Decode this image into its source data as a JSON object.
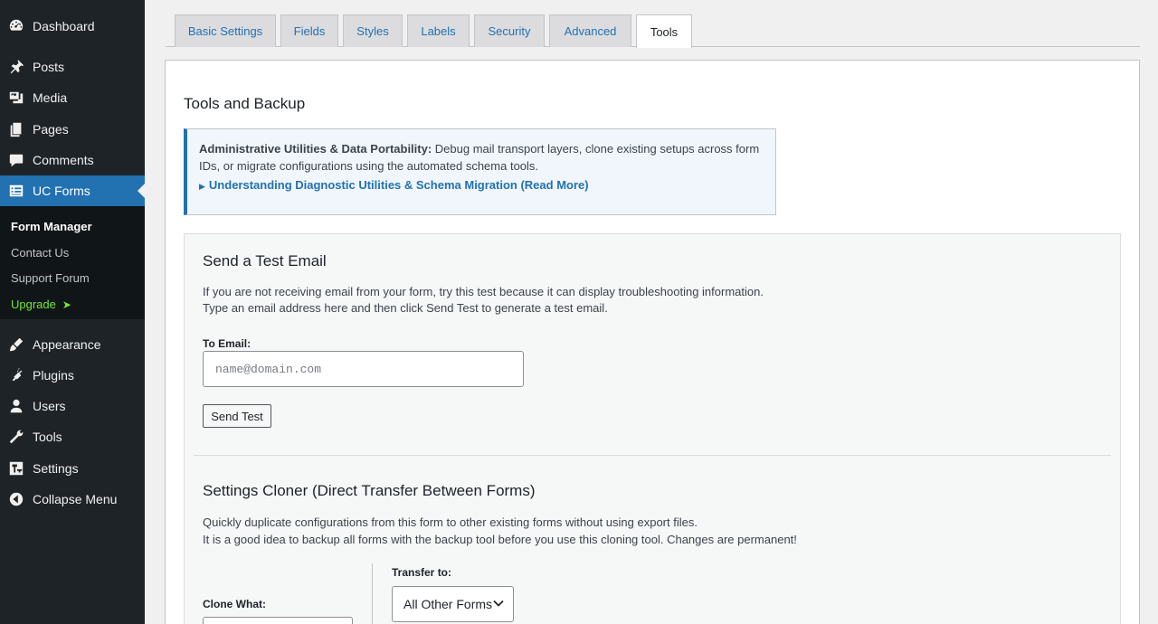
{
  "sidebar": {
    "items": [
      {
        "label": "Dashboard",
        "icon": "dashboard-icon"
      },
      {
        "label": "Posts",
        "icon": "pin-icon"
      },
      {
        "label": "Media",
        "icon": "media-icon"
      },
      {
        "label": "Pages",
        "icon": "pages-icon"
      },
      {
        "label": "Comments",
        "icon": "comment-icon"
      },
      {
        "label": "UC Forms",
        "icon": "form-icon"
      },
      {
        "label": "Appearance",
        "icon": "brush-icon"
      },
      {
        "label": "Plugins",
        "icon": "plugin-icon"
      },
      {
        "label": "Users",
        "icon": "user-icon"
      },
      {
        "label": "Tools",
        "icon": "wrench-icon"
      },
      {
        "label": "Settings",
        "icon": "settings-icon"
      },
      {
        "label": "Collapse Menu",
        "icon": "collapse-icon"
      }
    ],
    "submenu": [
      {
        "label": "Form Manager"
      },
      {
        "label": "Contact Us"
      },
      {
        "label": "Support Forum"
      },
      {
        "label": "Upgrade",
        "arrow": "➤"
      }
    ],
    "accent_color": "#2271b1",
    "upgrade_color": "#72e832"
  },
  "tabs": [
    "Basic Settings",
    "Fields",
    "Styles",
    "Labels",
    "Security",
    "Advanced",
    "Tools"
  ],
  "active_tab": "Tools",
  "panel": {
    "title": "Tools and Backup",
    "notice": {
      "strong": "Administrative Utilities & Data Portability:",
      "text": " Debug mail transport layers, clone existing setups across form IDs, or migrate configurations using the automated schema tools.",
      "link": "Understanding Diagnostic Utilities & Schema Migration (Read More)",
      "link_marker": "▶"
    },
    "test_email": {
      "title": "Send a Test Email",
      "desc1": "If you are not receiving email from your form, try this test because it can display troubleshooting information.",
      "desc2": "Type an email address here and then click Send Test to generate a test email.",
      "label": "To Email:",
      "placeholder": "name@domain.com",
      "button": "Send Test"
    },
    "cloner": {
      "title": "Settings Cloner (Direct Transfer Between Forms)",
      "desc1": "Quickly duplicate configurations from this form to other existing forms without using export files.",
      "desc2": "It is a good idea to backup all forms with the backup tool before you use this cloning tool. Changes are permanent!",
      "clone_label": "Clone What:",
      "transfer_label": "Transfer to:",
      "transfer_value": "All Other Forms"
    }
  }
}
